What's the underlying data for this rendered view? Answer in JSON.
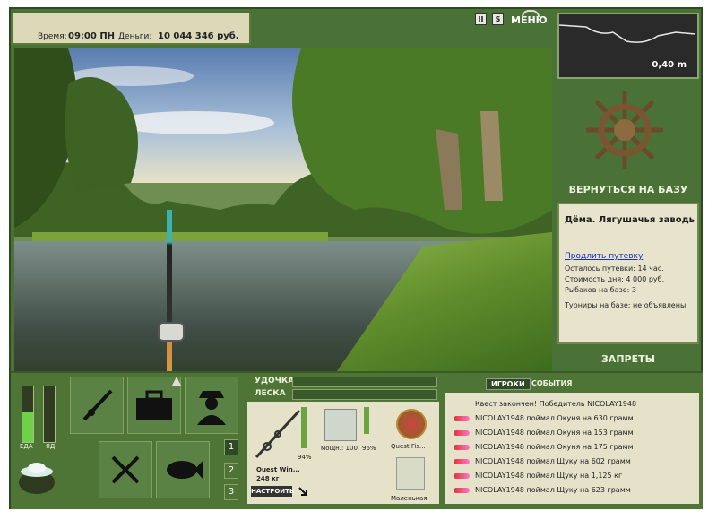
{
  "status": {
    "time_label": "Время:",
    "time_value": "09:00 ПН",
    "money_label": "Деньги:",
    "money_value": "10 044 346 руб."
  },
  "top_icons": {
    "pause": "II",
    "sound": "S"
  },
  "menu": {
    "label": "МЕНЮ"
  },
  "depth": {
    "value": "0,40 m"
  },
  "base": {
    "return_label": "ВЕРНУТЬСЯ НА БАЗУ",
    "location_title": "Дёма. Лягушачья заводь",
    "extend_link": "Продлить путевку",
    "remaining": "Осталось путевки: 14 час.",
    "day_cost": "Стоимость дня: 4 000 руб.",
    "fishers": "Рыбаков на базе: 3",
    "tournaments": "Турниры на базе: не объявлены",
    "bans_label": "ЗАПРЕТЫ"
  },
  "needs": {
    "food_label": "ЕДА",
    "poison_label": "ЯД",
    "food_level": 0.55,
    "poison_level": 0.0
  },
  "action_buttons": {
    "rod_icon": "fishing-rod-icon",
    "box_icon": "tackle-box-icon",
    "angler_icon": "angler-icon",
    "food_icon": "fork-knife-icon",
    "fish_icon": "fish-icon"
  },
  "slots": [
    "1",
    "2",
    "3"
  ],
  "gear": {
    "rod_label": "УДОЧКА",
    "line_label": "ЛЕСКА",
    "rod_name": "Quest Win...",
    "rod_weight": "248 кг",
    "rod_percent": "94%",
    "reel_stat": "мощн.: 100",
    "reel_percent": "96%",
    "lure1_name": "Quest Fis...",
    "lure2_name": "Маленькая",
    "adjust_button": "НАСТРОИТЬ"
  },
  "events": {
    "tab_players": "ИГРОКИ",
    "tab_events": "СОБЫТИЯ",
    "items": [
      "Квест закончен! Победитель NICOLAY1948",
      "NICOLAY1948 поймал Окуня на 630 грамм",
      "NICOLAY1948 поймал Окуня на 153 грамм",
      "NICOLAY1948 поймал Окуня на 175 грамм",
      "NICOLAY1948 поймал Щуку на 602 грамм",
      "NICOLAY1948 поймал Щуку на 1,125 кг",
      "NICOLAY1948 поймал Щуку на 623 грамм"
    ]
  }
}
